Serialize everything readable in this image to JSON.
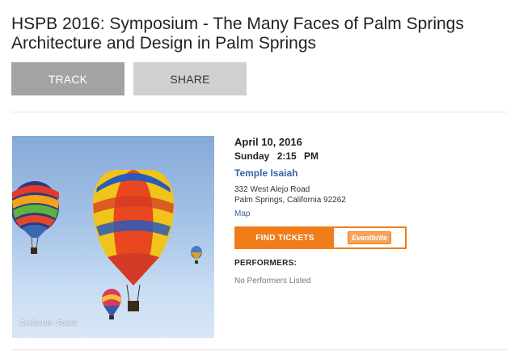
{
  "event": {
    "title": "HSPB 2016: Symposium - The Many Faces of Palm Springs Architecture and Design in Palm Springs"
  },
  "actions": {
    "track_label": "TRACK",
    "share_label": "SHARE"
  },
  "photo": {
    "credit": "Cecilia Lim - Fotolia"
  },
  "details": {
    "date": "April 10, 2016",
    "day": "Sunday",
    "time": "2:15 PM",
    "venue_name": "Temple Isaiah",
    "address_line1": "332 West Alejo Road",
    "address_line2": "Palm Springs, California 92262",
    "map_label": "Map"
  },
  "tickets": {
    "button_label": "FIND TICKETS",
    "provider": "Eventbrite"
  },
  "performers": {
    "label": "PERFORMERS:",
    "value": "No Performers Listed"
  },
  "colors": {
    "accent": "#f07d1a",
    "link": "#3b62a6"
  }
}
